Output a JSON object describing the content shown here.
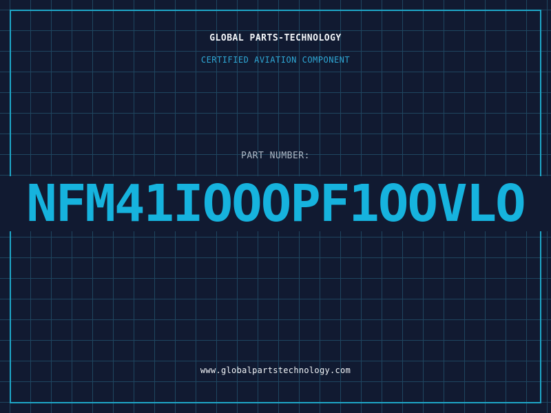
{
  "header": {
    "brand": "GLOBAL PARTS-TECHNOLOGY",
    "subtitle": "CERTIFIED AVIATION COMPONENT"
  },
  "main": {
    "label": "PART NUMBER:",
    "part_number": "NFM41IOOOPF1OOVLO"
  },
  "footer": {
    "website": "www.globalpartstechnology.com"
  },
  "colors": {
    "background": "#111a31",
    "grid": "#1f4660",
    "accent": "#16b3de",
    "frame": "#1ea7c8"
  }
}
